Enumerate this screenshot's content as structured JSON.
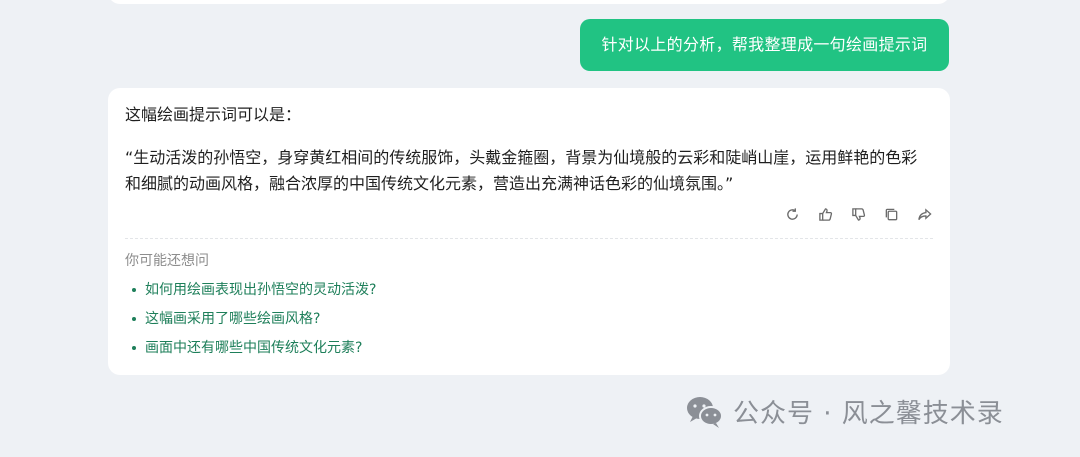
{
  "conversation": {
    "user_message": "针对以上的分析，帮我整理成一句绘画提示词",
    "answer_intro": "这幅绘画提示词可以是：",
    "answer_body": "“生动活泼的孙悟空，身穿黄红相间的传统服饰，头戴金箍圈，背景为仙境般的云彩和陡峭山崖，运用鲜艳的色彩和细腻的动画风格，融合浓厚的中国传统文化元素，营造出充满神话色彩的仙境氛围。”",
    "actions": [
      "refresh-icon",
      "thumb-up-icon",
      "thumb-down-icon",
      "copy-icon",
      "share-icon"
    ]
  },
  "suggestions": {
    "title": "你可能还想问",
    "items": [
      "如何用绘画表现出孙悟空的灵动活泼?",
      "这幅画采用了哪些绘画风格?",
      "画面中还有哪些中国传统文化元素?"
    ]
  },
  "watermark": {
    "text": "公众号 · 风之馨技术录",
    "icon": "wechat-icon"
  },
  "colors": {
    "accent": "#21c383",
    "link": "#1e7f5a",
    "background": "#eef1f5"
  }
}
